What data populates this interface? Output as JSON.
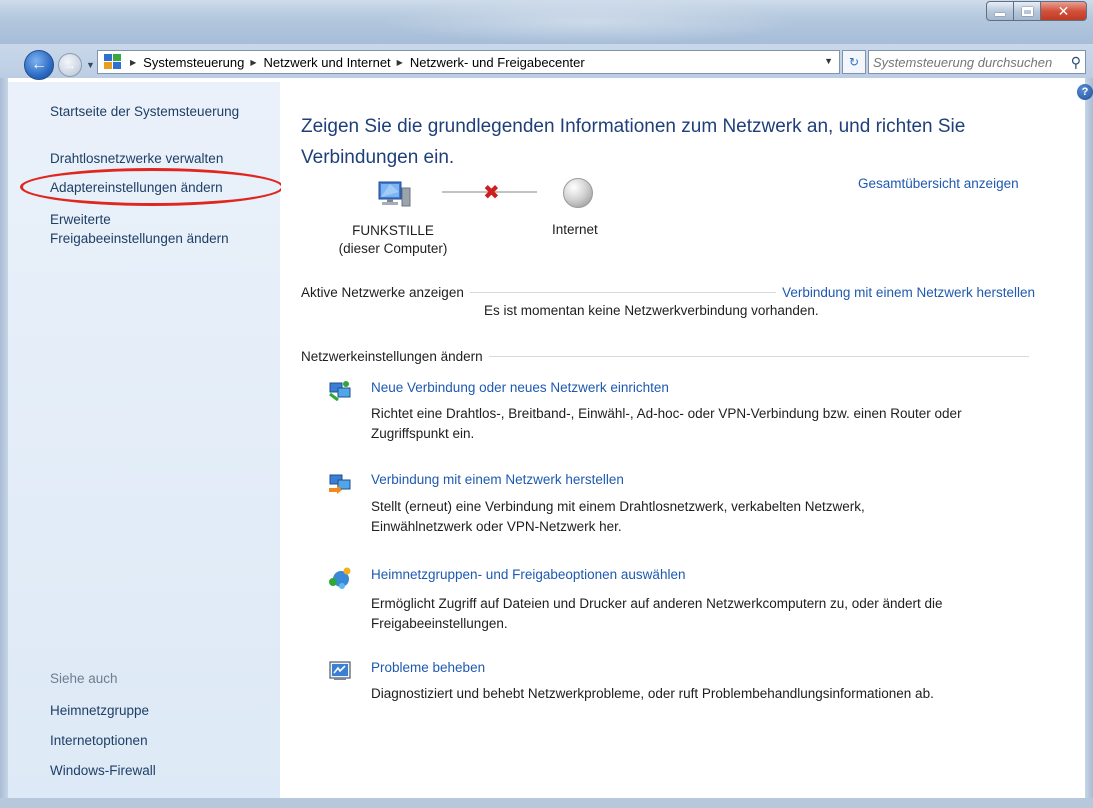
{
  "window": {
    "controls": [
      "minimize",
      "maximize",
      "close"
    ]
  },
  "address_bar": {
    "crumbs": [
      "Systemsteuerung",
      "Netzwerk und Internet",
      "Netzwerk- und Freigabecenter"
    ]
  },
  "search": {
    "placeholder": "Systemsteuerung durchsuchen"
  },
  "sidebar": {
    "home": "Startseite der Systemsteuerung",
    "items": [
      "Drahtlosnetzwerke verwalten",
      "Adaptereinstellungen ändern",
      "Erweiterte",
      "Freigabeeinstellungen ändern"
    ],
    "see_also_title": "Siehe auch",
    "see_also": [
      "Heimnetzgruppe",
      "Internetoptionen",
      "Windows-Firewall"
    ]
  },
  "main": {
    "title_line1": "Zeigen Sie die grundlegenden Informationen zum Netzwerk an, und richten Sie",
    "title_line2": "Verbindungen ein.",
    "overview_link": "Gesamtübersicht anzeigen",
    "computer_name": "FUNKSTILLE",
    "computer_sub": "(dieser Computer)",
    "internet_label": "Internet",
    "active_networks": "Aktive Netzwerke anzeigen",
    "connect_link": "Verbindung mit einem Netzwerk herstellen",
    "no_connection": "Es ist momentan keine Netzwerkverbindung vorhanden.",
    "change_settings": "Netzwerkeinstellungen ändern",
    "tasks": [
      {
        "title": "Neue Verbindung oder neues Netzwerk einrichten",
        "desc1": "Richtet eine Drahtlos-, Breitband-, Einwähl-, Ad-hoc- oder VPN-Verbindung bzw. einen Router oder",
        "desc2": "Zugriffspunkt ein."
      },
      {
        "title": "Verbindung mit einem Netzwerk herstellen",
        "desc1": "Stellt (erneut) eine Verbindung mit einem Drahtlosnetzwerk, verkabelten Netzwerk,",
        "desc2": "Einwählnetzwerk oder VPN-Netzwerk her."
      },
      {
        "title": "Heimnetzgruppen- und Freigabeoptionen auswählen",
        "desc1": "Ermöglicht Zugriff auf Dateien und Drucker auf anderen Netzwerkcomputern zu, oder ändert die",
        "desc2": "Freigabeeinstellungen."
      },
      {
        "title": "Probleme beheben",
        "desc1": "Diagnostiziert und behebt Netzwerkprobleme, oder ruft Problembehandlungsinformationen ab.",
        "desc2": ""
      }
    ]
  },
  "colors": {
    "link": "#1e59b0",
    "sidebar_link": "#1e3f66",
    "title": "#1e3f7a",
    "highlight_ring": "#e0261e",
    "sidebar_bg": "#eaf1fa"
  }
}
